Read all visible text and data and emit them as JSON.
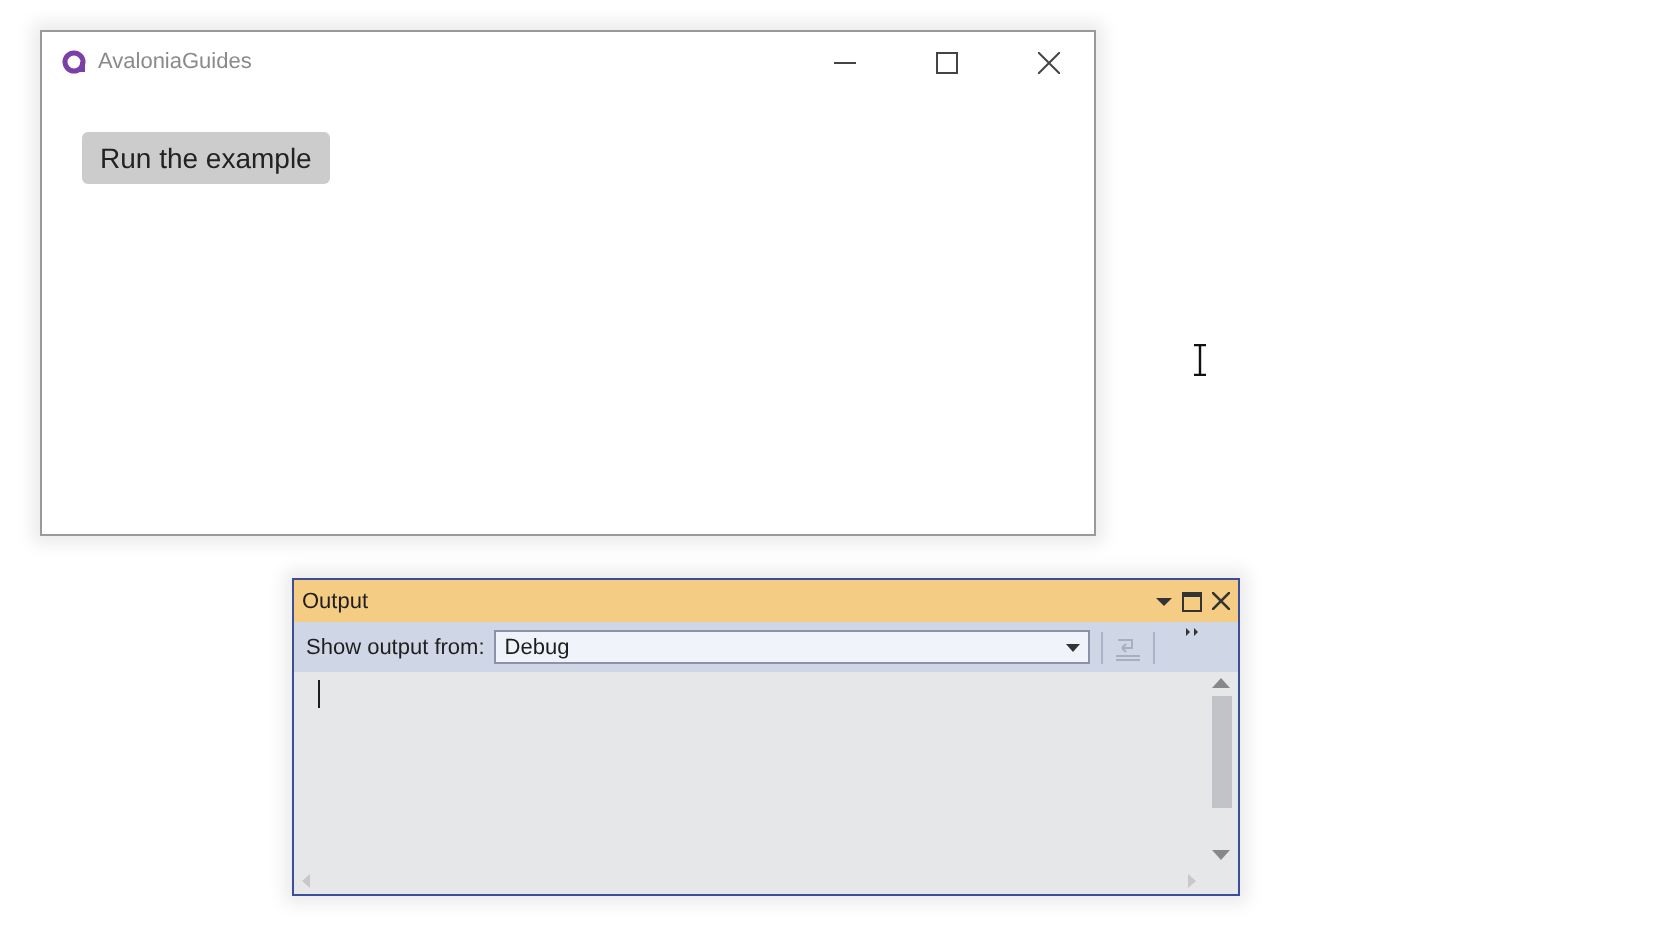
{
  "app_window": {
    "title": "AvaloniaGuides",
    "button": "Run the example"
  },
  "output_window": {
    "title": "Output",
    "show_label": "Show output from:",
    "source": "Debug"
  }
}
